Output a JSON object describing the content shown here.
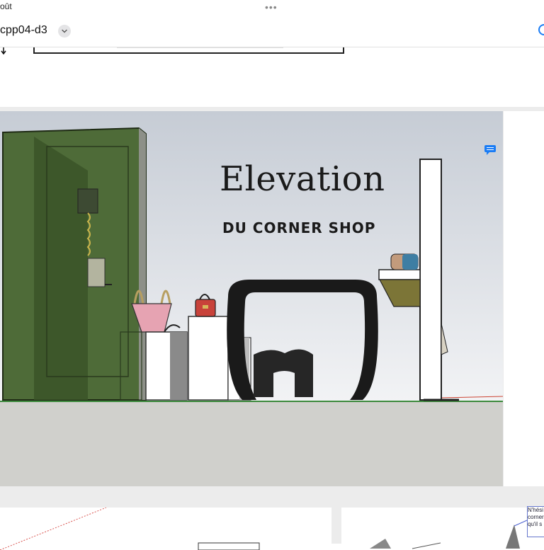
{
  "status_bar": {
    "date_fragment": "oût"
  },
  "document": {
    "title": "cpp04-d3"
  },
  "slide": {
    "title": "Elevation",
    "subtitle": "DU CORNER SHOP"
  },
  "note": {
    "lines": [
      "N'hési",
      "corner",
      "qu'il s"
    ]
  },
  "icons": {
    "more": "more-dots-icon",
    "chevron": "chevron-down-icon",
    "search": "search-icon",
    "comment": "comment-icon",
    "arrow": "arrow-down-icon"
  },
  "colors": {
    "sketch_bg_top": "#c9ced6",
    "ground": "#d0d0cc",
    "accent_blue": "#1a7cf5",
    "glass_green": "#4e6b38"
  }
}
